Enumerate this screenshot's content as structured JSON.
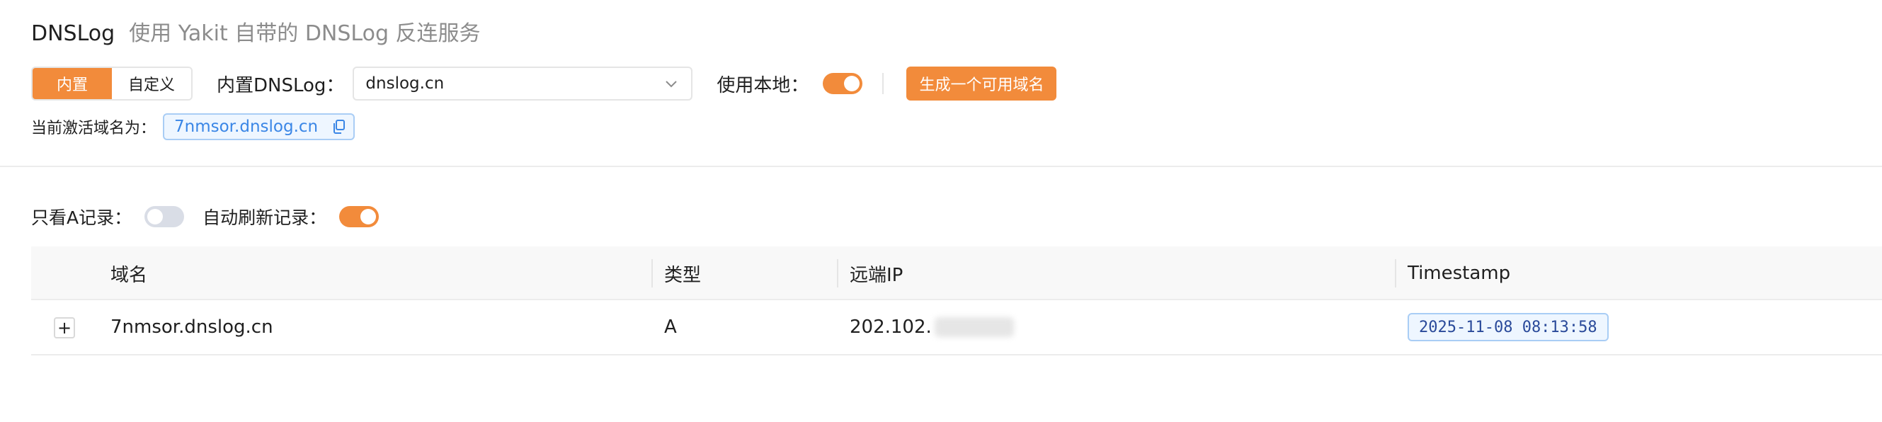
{
  "header": {
    "title": "DNSLog",
    "subtitle": "使用 Yakit 自带的 DNSLog 反连服务"
  },
  "mode_switch": {
    "options": [
      "内置",
      "自定义"
    ],
    "selected": "内置"
  },
  "builtin_dnslog": {
    "label": "内置DNSLog：",
    "value": "dnslog.cn"
  },
  "use_local": {
    "label": "使用本地：",
    "enabled": true
  },
  "generate_button": "生成一个可用域名",
  "active_domain": {
    "label": "当前激活域名为：",
    "value": "7nmsor.dnslog.cn"
  },
  "filters": {
    "only_a_label": "只看A记录：",
    "only_a_enabled": false,
    "auto_refresh_label": "自动刷新记录：",
    "auto_refresh_enabled": true
  },
  "table": {
    "columns": [
      "域名",
      "类型",
      "远端IP",
      "Timestamp"
    ],
    "rows": [
      {
        "expand": "+",
        "domain": "7nmsor.dnslog.cn",
        "type": "A",
        "remote_ip": "202.102.",
        "timestamp": "2025-11-08 08:13:58"
      }
    ]
  },
  "colors": {
    "accent": "#f28b3b",
    "tag_border": "#a9cdf5",
    "tag_bg": "#eef6ff"
  }
}
